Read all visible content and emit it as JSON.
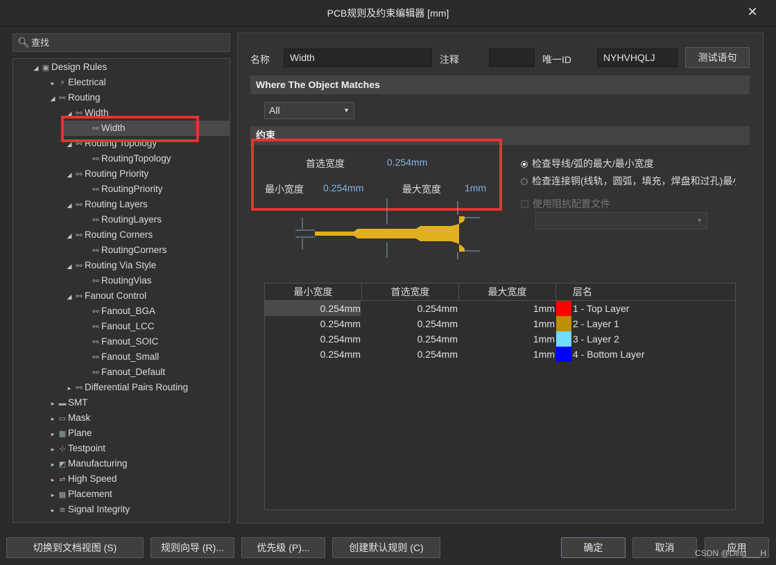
{
  "window": {
    "title": "PCB规则及约束编辑器 [mm]",
    "close_glyph": "✕"
  },
  "search": {
    "icon": "search-icon",
    "value": "查找"
  },
  "tree": [
    {
      "label": "Design Rules",
      "arrow": "◢",
      "icon": "folder-icon",
      "glyph": "▣"
    },
    {
      "label": "Electrical",
      "arrow": "▸",
      "icon": "electrical-icon",
      "glyph": "⚡"
    },
    {
      "label": "Routing",
      "arrow": "◢",
      "icon": "routing-icon",
      "glyph": "⚯"
    },
    {
      "label": "Width",
      "arrow": "◢",
      "icon": "width-icon",
      "glyph": "⚯"
    },
    {
      "label": "Width",
      "arrow": "",
      "icon": "rule-icon",
      "glyph": "⚯"
    },
    {
      "label": "Routing Topology",
      "arrow": "◢",
      "icon": "topology-icon",
      "glyph": "⚯"
    },
    {
      "label": "RoutingTopology",
      "arrow": "",
      "icon": "rule-icon",
      "glyph": "⚯"
    },
    {
      "label": "Routing Priority",
      "arrow": "◢",
      "icon": "priority-icon",
      "glyph": "⚯"
    },
    {
      "label": "RoutingPriority",
      "arrow": "",
      "icon": "rule-icon",
      "glyph": "⚯"
    },
    {
      "label": "Routing Layers",
      "arrow": "◢",
      "icon": "layers-icon",
      "glyph": "⚯"
    },
    {
      "label": "RoutingLayers",
      "arrow": "",
      "icon": "rule-icon",
      "glyph": "⚯"
    },
    {
      "label": "Routing Corners",
      "arrow": "◢",
      "icon": "corners-icon",
      "glyph": "⚯"
    },
    {
      "label": "RoutingCorners",
      "arrow": "",
      "icon": "rule-icon",
      "glyph": "⚯"
    },
    {
      "label": "Routing Via Style",
      "arrow": "◢",
      "icon": "via-icon",
      "glyph": "⚯"
    },
    {
      "label": "RoutingVias",
      "arrow": "",
      "icon": "rule-icon",
      "glyph": "⚯"
    },
    {
      "label": "Fanout Control",
      "arrow": "◢",
      "icon": "fanout-icon",
      "glyph": "⚯"
    },
    {
      "label": "Fanout_BGA",
      "arrow": "",
      "icon": "rule-icon",
      "glyph": "⚯"
    },
    {
      "label": "Fanout_LCC",
      "arrow": "",
      "icon": "rule-icon",
      "glyph": "⚯"
    },
    {
      "label": "Fanout_SOIC",
      "arrow": "",
      "icon": "rule-icon",
      "glyph": "⚯"
    },
    {
      "label": "Fanout_Small",
      "arrow": "",
      "icon": "rule-icon",
      "glyph": "⚯"
    },
    {
      "label": "Fanout_Default",
      "arrow": "",
      "icon": "rule-icon",
      "glyph": "⚯"
    },
    {
      "label": "Differential Pairs Routing",
      "arrow": "▸",
      "icon": "diffpair-icon",
      "glyph": "⚯"
    },
    {
      "label": "SMT",
      "arrow": "▸",
      "icon": "smt-icon",
      "glyph": "▬"
    },
    {
      "label": "Mask",
      "arrow": "▸",
      "icon": "mask-icon",
      "glyph": "▭"
    },
    {
      "label": "Plane",
      "arrow": "▸",
      "icon": "plane-icon",
      "glyph": "▩"
    },
    {
      "label": "Testpoint",
      "arrow": "▸",
      "icon": "testpoint-icon",
      "glyph": "⊹"
    },
    {
      "label": "Manufacturing",
      "arrow": "▸",
      "icon": "manufacturing-icon",
      "glyph": "◩"
    },
    {
      "label": "High Speed",
      "arrow": "▸",
      "icon": "highspeed-icon",
      "glyph": "⇌"
    },
    {
      "label": "Placement",
      "arrow": "▸",
      "icon": "placement-icon",
      "glyph": "▦"
    },
    {
      "label": "Signal Integrity",
      "arrow": "▸",
      "icon": "signal-icon",
      "glyph": "≋"
    }
  ],
  "rule": {
    "name_label": "名称",
    "name_value": "Width",
    "comment_label": "注释",
    "comment_value": "",
    "uid_label": "唯一ID",
    "uid_value": "NYHVHQLJ",
    "test_button": "测试语句"
  },
  "match": {
    "header": "Where The Object Matches",
    "scope": "All"
  },
  "constraints": {
    "header": "约束",
    "pref_label": "首选宽度",
    "pref_value": "0.254mm",
    "min_label": "最小宽度",
    "min_value": "0.254mm",
    "max_label": "最大宽度",
    "max_value": "1mm",
    "radio1": "检查导线/弧的最大/最小宽度",
    "radio2": "检查连接铜(线轨，圆弧，填充，焊盘和过孔)最小",
    "impedance_label": "使用阻抗配置文件",
    "impedance_value": ""
  },
  "grid": {
    "headers": [
      "最小宽度",
      "首选宽度",
      "最大宽度",
      "层名"
    ],
    "rows": [
      {
        "min": "0.254mm",
        "pref": "0.254mm",
        "max": "1mm",
        "layer": "1 - Top Layer",
        "color": "#ff0000"
      },
      {
        "min": "0.254mm",
        "pref": "0.254mm",
        "max": "1mm",
        "layer": "2 - Layer 1",
        "color": "#bc8e00"
      },
      {
        "min": "0.254mm",
        "pref": "0.254mm",
        "max": "1mm",
        "layer": "3 - Layer 2",
        "color": "#70dbff"
      },
      {
        "min": "0.254mm",
        "pref": "0.254mm",
        "max": "1mm",
        "layer": "4 - Bottom Layer",
        "color": "#0000ff"
      }
    ]
  },
  "buttons": {
    "doc_view": "切换到文档视图 (S)",
    "wizard": "规则向导 (R)...",
    "priority": "优先级 (P)...",
    "default_rules": "创建默认规则 (C)",
    "ok": "确定",
    "cancel": "取消",
    "apply": "应用"
  },
  "watermark": "CSDN @Ding___H"
}
